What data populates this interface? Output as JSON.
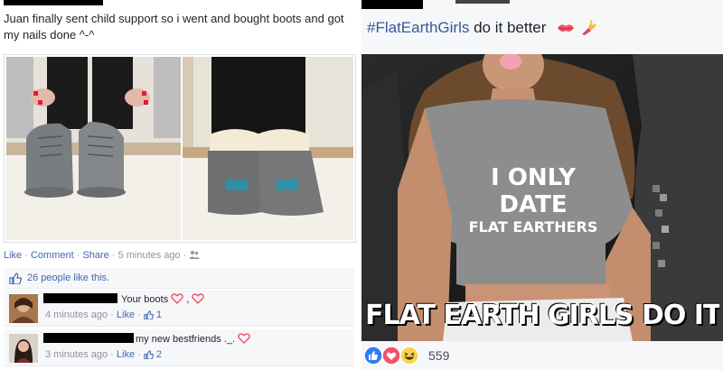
{
  "left_post": {
    "text": "Juan finally sent child support so i went and bought boots and got my nails done ^-^",
    "actions": {
      "like": "Like",
      "sep1": " · ",
      "comment": "Comment",
      "sep2": " · ",
      "share": "Share",
      "sep3": " · ",
      "time": "5 minutes ago",
      "sep4": " · "
    },
    "likes_text": "26 people like this.",
    "comments": [
      {
        "text": "Your boots",
        "tail": " ,",
        "time": "4 minutes ago",
        "like": "Like",
        "count": "1"
      },
      {
        "text": "my new bestfriends ._.",
        "tail": "",
        "time": "3 minutes ago",
        "like": "Like",
        "count": "2"
      }
    ]
  },
  "right_post": {
    "hashtag": "#FlatEarthGirls",
    "text_after": " do it better",
    "shirt_lines": [
      "I ONLY",
      "DATE",
      "FLAT EARTHERS"
    ],
    "overlay_caption": "FLAT EARTH GIRLS DO IT BETTE",
    "reaction_count": "559"
  },
  "colors": {
    "link": "#4267b2",
    "hashtag": "#365899",
    "meta": "#90949c",
    "love": "#f25268",
    "like_blue": "#2f7df6",
    "haha_yellow": "#fcd34d"
  },
  "icons": [
    "thumbs-up-icon",
    "heart-icon",
    "like-reaction-icon",
    "love-reaction-icon",
    "haha-reaction-icon",
    "globe-friends-icon",
    "kiss-emoji-icon",
    "nail-polish-emoji-icon"
  ]
}
